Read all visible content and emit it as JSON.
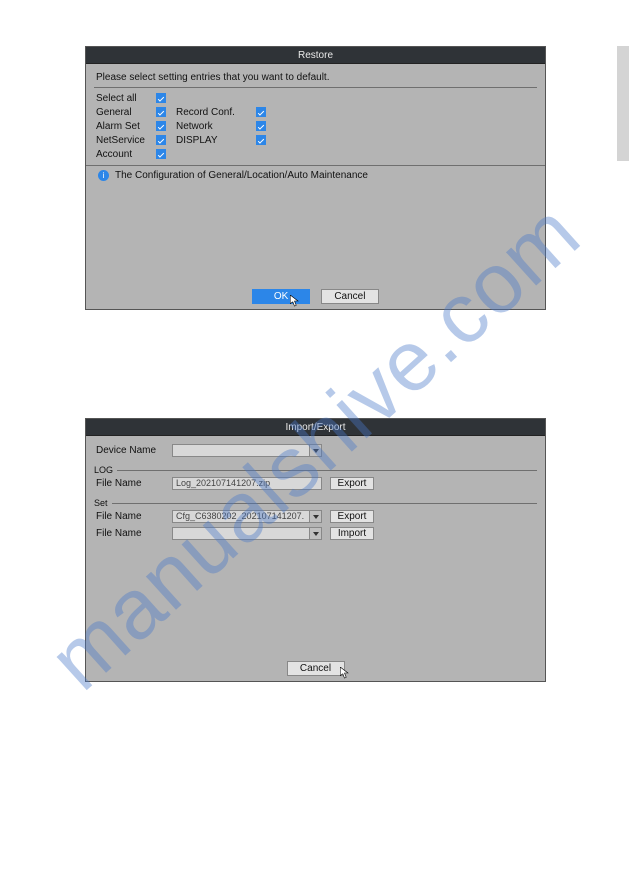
{
  "watermark": "manualshive.com",
  "restore": {
    "title": "Restore",
    "prompt": "Please select setting entries that you want to default.",
    "rows": [
      {
        "left": "Select all"
      },
      {
        "left": "General",
        "right": "Record Conf."
      },
      {
        "left": "Alarm Set",
        "right": "Network"
      },
      {
        "left": "NetService",
        "right": "DISPLAY"
      },
      {
        "left": "Account"
      }
    ],
    "info": "The Configuration of General/Location/Auto Maintenance",
    "ok": "OK",
    "cancel": "Cancel"
  },
  "impexp": {
    "title": "Import/Export",
    "device_label": "Device Name",
    "device_value": "",
    "log_group": "LOG",
    "log_file_label": "File Name",
    "log_file_value": "Log_202107141207.zip",
    "export": "Export",
    "set_group": "Set",
    "set_file_label": "File Name",
    "set_file_value": "Cfg_C6380202_202107141207.",
    "imp_file_label": "File Name",
    "imp_file_value": "",
    "import": "Import",
    "cancel": "Cancel"
  }
}
